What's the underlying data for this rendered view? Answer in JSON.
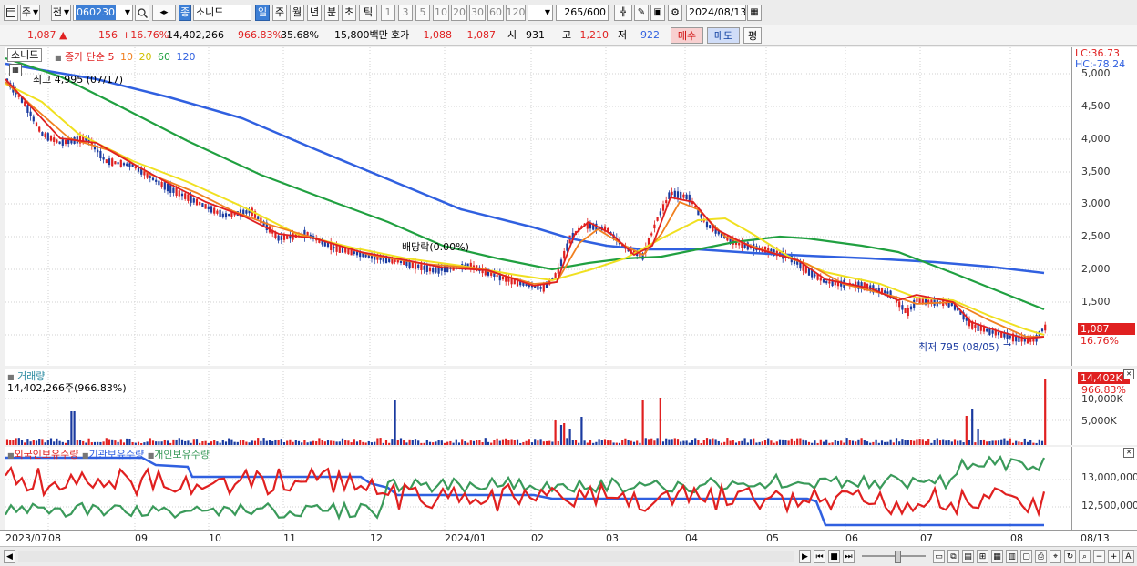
{
  "toolbar": {
    "market_select": "주",
    "market_type": "전",
    "stock_code": "060230",
    "stock_badge": "종",
    "stock_name": "소니드",
    "period_tabs": [
      "일",
      "주",
      "월",
      "년",
      "분",
      "초",
      "틱"
    ],
    "interval_buttons": [
      "1",
      "3",
      "5",
      "10",
      "20",
      "30",
      "60",
      "120"
    ],
    "count_value": "265",
    "count_total": "/600",
    "date_value": "2024/08/13"
  },
  "quote": {
    "price": "1,087",
    "change": "156",
    "change_pct": "+16.76%",
    "volume": "14,402,266",
    "volume_ratio": "966.83%",
    "turnover": "35.68%",
    "amount": "15,800백만",
    "hoga_label": "호가",
    "ask": "1,088",
    "bid": "1,087",
    "open_label": "시",
    "open": "931",
    "high_label": "고",
    "high": "1,210",
    "low_label": "저",
    "low": "922",
    "buy_button": "매수",
    "sell_button": "매도",
    "eval_button": "평"
  },
  "price_panel": {
    "legend_name": "소니드",
    "legend_ma_label": "종가 단순",
    "ma_periods": [
      "5",
      "10",
      "20",
      "60",
      "120"
    ],
    "ma_colors": [
      "#e02020",
      "#f08020",
      "#f0e020",
      "#20a040",
      "#3060e0"
    ],
    "lc_label": "LC:36.73",
    "hc_label": "HC:-78.24",
    "yticks": [
      "5,000",
      "4,500",
      "4,000",
      "3,500",
      "3,000",
      "2,500",
      "2,000",
      "1,500"
    ],
    "current_price_tag": "1,087",
    "current_pct_tag": "16.76%",
    "high_annotation": "최고 4,995 (07/17)",
    "low_annotation": "최저 795 (08/05)",
    "dividend_annotation": "배당락(0.00%)"
  },
  "volume_panel": {
    "title": "거래량",
    "value_label": "14,402,266주(966.83%)",
    "tag": "14,402K",
    "tag_pct": "966.83%",
    "yticks": [
      "10,000K",
      "5,000K"
    ]
  },
  "holdings_panel": {
    "series_labels": [
      "외국인보유수량",
      "기관보유수량",
      "개인보유수량"
    ],
    "series_colors": [
      "#e02020",
      "#3060e0",
      "#3a9a5a"
    ],
    "yticks": [
      "13,000,000",
      "12,500,000"
    ]
  },
  "x_axis": {
    "labels": [
      "2023/07",
      "08",
      "09",
      "10",
      "11",
      "12",
      "2024/01",
      "02",
      "03",
      "04",
      "05",
      "06",
      "07",
      "08"
    ],
    "right_label": "08/13"
  }
}
